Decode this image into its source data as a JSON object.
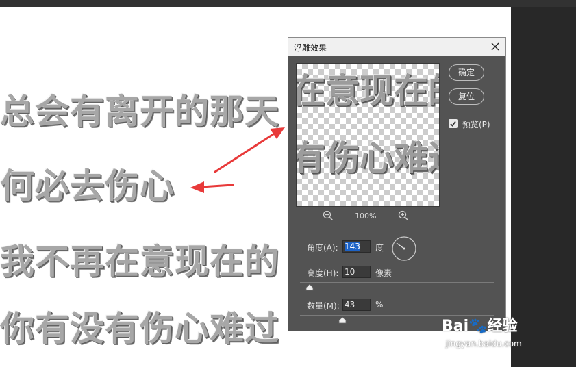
{
  "canvas": {
    "lines": [
      "总会有离开的那天",
      "何必去伤心",
      "我不再在意现在的",
      "你有没有伤心难过"
    ]
  },
  "dialog": {
    "title": "浮雕效果",
    "ok_label": "确定",
    "reset_label": "复位",
    "preview_label": "预览(P)",
    "preview_checked": true,
    "preview_text": [
      "在意现在的",
      "有伤心难过"
    ],
    "zoom_level": "100%",
    "angle_label": "角度(A):",
    "angle_value": "143",
    "angle_unit": "度",
    "height_label": "高度(H):",
    "height_value": "10",
    "height_unit": "像素",
    "amount_label": "数量(M):",
    "amount_value": "43",
    "amount_unit": "%",
    "height_slider_fraction": 0.05,
    "amount_slider_fraction": 0.22
  },
  "watermark": {
    "brand": "Bai🐾经验",
    "url": "jingyan.baidu.com"
  },
  "colors": {
    "arrow": "#e83a3a",
    "selection": "#1d63c7",
    "dialog_bg": "#535353"
  },
  "icons": {
    "close": "close-icon",
    "zoom_out": "zoom-out-icon",
    "zoom_in": "zoom-in-icon",
    "dial": "angle-dial-icon",
    "check": "check-icon"
  }
}
